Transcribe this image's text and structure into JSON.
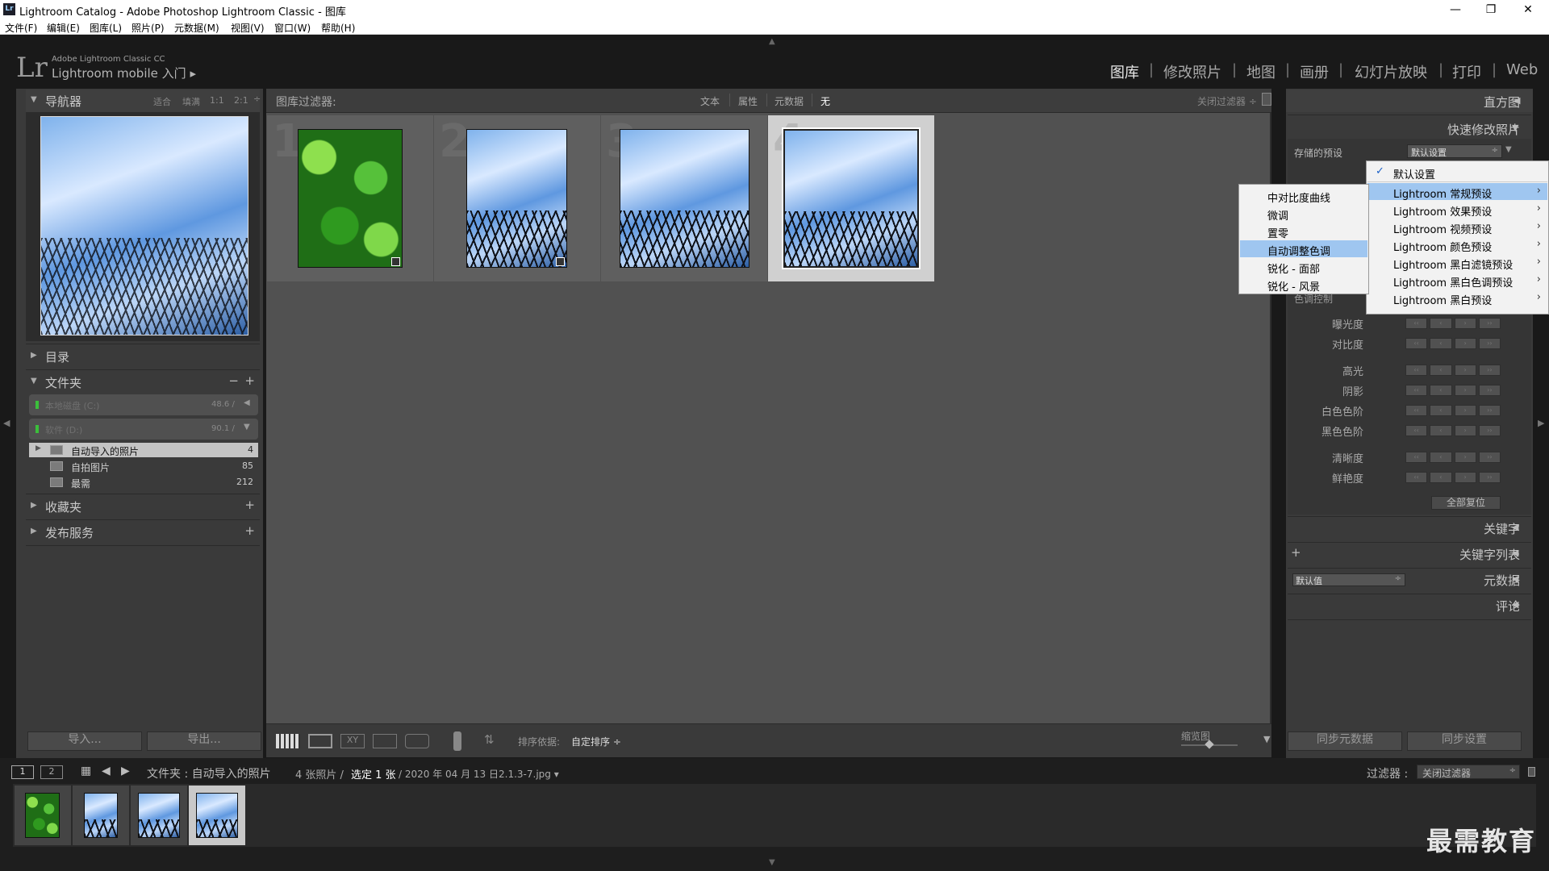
{
  "window": {
    "title": "Lightroom Catalog - Adobe Photoshop Lightroom Classic - 图库",
    "app_icon": "Lr",
    "minimize": "—",
    "maximize": "❐",
    "close": "✕"
  },
  "menubar": [
    "文件(F)",
    "编辑(E)",
    "图库(L)",
    "照片(P)",
    "元数据(M)",
    "视图(V)",
    "窗口(W)",
    "帮助(H)"
  ],
  "identity": {
    "logo": "Lr",
    "product": "Adobe Lightroom Classic CC",
    "mobile": "Lightroom mobile 入门",
    "arrow": "▸"
  },
  "modules": [
    "图库",
    "修改照片",
    "地图",
    "画册",
    "幻灯片放映",
    "打印",
    "Web"
  ],
  "module_sep": "|",
  "navigator": {
    "label": "导航器",
    "fit": "适合",
    "fill": "填满",
    "r11": "1:1",
    "r21": "2:1"
  },
  "left_panels": {
    "catalog": "目录",
    "folders": "文件夹",
    "collections": "收藏夹",
    "publish": "发布服务",
    "minus": "−",
    "plus": "+"
  },
  "volumes": [
    {
      "name": "本地磁盘 (C:)",
      "size": "48.6 / "
    },
    {
      "name": "软件 (D:)",
      "size": "90.1 / "
    }
  ],
  "folders": [
    {
      "name": "自动导入的照片",
      "count": "4"
    },
    {
      "name": "自拍图片",
      "count": "85"
    },
    {
      "name": "最需",
      "count": "212"
    }
  ],
  "import_btn": "导入...",
  "export_btn": "导出...",
  "filterbar": {
    "label": "图库过滤器:",
    "text": "文本",
    "attr": "属性",
    "meta": "元数据",
    "none": "无",
    "close": "关闭过滤器 ÷"
  },
  "grid_cells": [
    "1",
    "2",
    "3",
    "4"
  ],
  "toolbar": {
    "sort_label": "排序依据:",
    "sort_value": "自定排序 ÷",
    "thumb_label": "缩览图"
  },
  "right": {
    "histogram": "直方图",
    "quick_develop": "快速修改照片",
    "saved_preset": "存储的预设",
    "preset_value": "默认设置",
    "tone": "色调控制",
    "sliders": [
      "曝光度",
      "对比度",
      "高光",
      "阴影",
      "白色色阶",
      "黑色色阶",
      "清晰度",
      "鲜艳度"
    ],
    "reset_all": "全部复位",
    "keywording": "关键字",
    "keyword_list": "关键字列表",
    "metadata": "元数据",
    "metadata_preset": "默认值",
    "comments": "评论",
    "sync_meta": "同步元数据",
    "sync_settings": "同步设置"
  },
  "preset_menu": [
    {
      "label": "默认设置",
      "checked": true
    },
    {
      "label": "Lightroom 常规预设",
      "highlight": true
    },
    {
      "label": "Lightroom 效果预设"
    },
    {
      "label": "Lightroom 视频预设"
    },
    {
      "label": "Lightroom 颜色预设"
    },
    {
      "label": "Lightroom 黑白滤镜预设"
    },
    {
      "label": "Lightroom 黑白色调预设"
    },
    {
      "label": "Lightroom 黑白预设"
    }
  ],
  "submenu": [
    {
      "label": "中对比度曲线"
    },
    {
      "label": "微调"
    },
    {
      "label": "置零"
    },
    {
      "label": "自动调整色调",
      "highlight": true
    },
    {
      "label": "锐化 - 面部"
    },
    {
      "label": "锐化 - 风景"
    }
  ],
  "filmstrip": {
    "p1": "1",
    "p2": "2",
    "path": "文件夹 : 自动导入的照片",
    "count": "4 张照片 /",
    "selected": "选定 1 张",
    "file": "/ 2020 年 04 月 13 日2.1.3-7.jpg ▾",
    "filter_label": "过滤器 :",
    "filter_value": "关闭过滤器"
  },
  "watermark": "最需教育",
  "colors": {
    "highlight": "#9fc6f0",
    "panel": "#3b3b3b",
    "dark": "#191919"
  }
}
